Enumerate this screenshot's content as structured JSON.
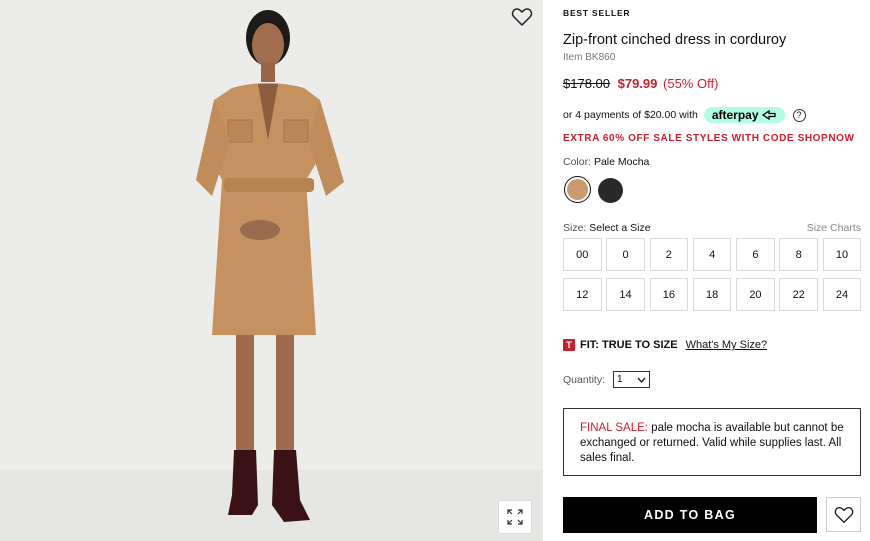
{
  "product": {
    "badge": "BEST SELLER",
    "title": "Zip-front cinched dress in corduroy",
    "item_no": "Item BK860",
    "price_old": "$178.00",
    "price_new": "$79.99",
    "price_off": "(55% Off)"
  },
  "afterpay": {
    "text": "or 4 payments of $20.00 with",
    "logo": "afterpay",
    "help": "?"
  },
  "promo": "EXTRA 60% OFF SALE STYLES WITH CODE SHOPNOW",
  "color": {
    "label": "Color:",
    "selected": "Pale Mocha",
    "swatches": [
      {
        "name": "pale-mocha",
        "hex": "#c99a6e"
      },
      {
        "name": "black",
        "hex": "#2a2828"
      }
    ]
  },
  "size": {
    "label": "Size:",
    "value": "Select a Size",
    "chart_link": "Size Charts",
    "options": [
      "00",
      "0",
      "2",
      "4",
      "6",
      "8",
      "10",
      "12",
      "14",
      "16",
      "18",
      "20",
      "22",
      "24"
    ]
  },
  "fit": {
    "tag": "T",
    "text": "FIT: TRUE TO SIZE",
    "link": "What's My Size?"
  },
  "quantity": {
    "label": "Quantity:",
    "value": "1"
  },
  "final_sale": {
    "label": "FINAL SALE:",
    "text": "pale mocha is available but cannot be exchanged or returned. Valid while supplies last. All sales final."
  },
  "actions": {
    "add_to_bag": "ADD TO BAG"
  },
  "icons": {
    "wishlist": "heart-icon",
    "expand": "expand-icon",
    "dropdown": "chevron-down-icon"
  },
  "colors": {
    "sale_red": "#c8202e",
    "afterpay_mint": "#b2fce4",
    "image_bg": "#ececeb"
  }
}
